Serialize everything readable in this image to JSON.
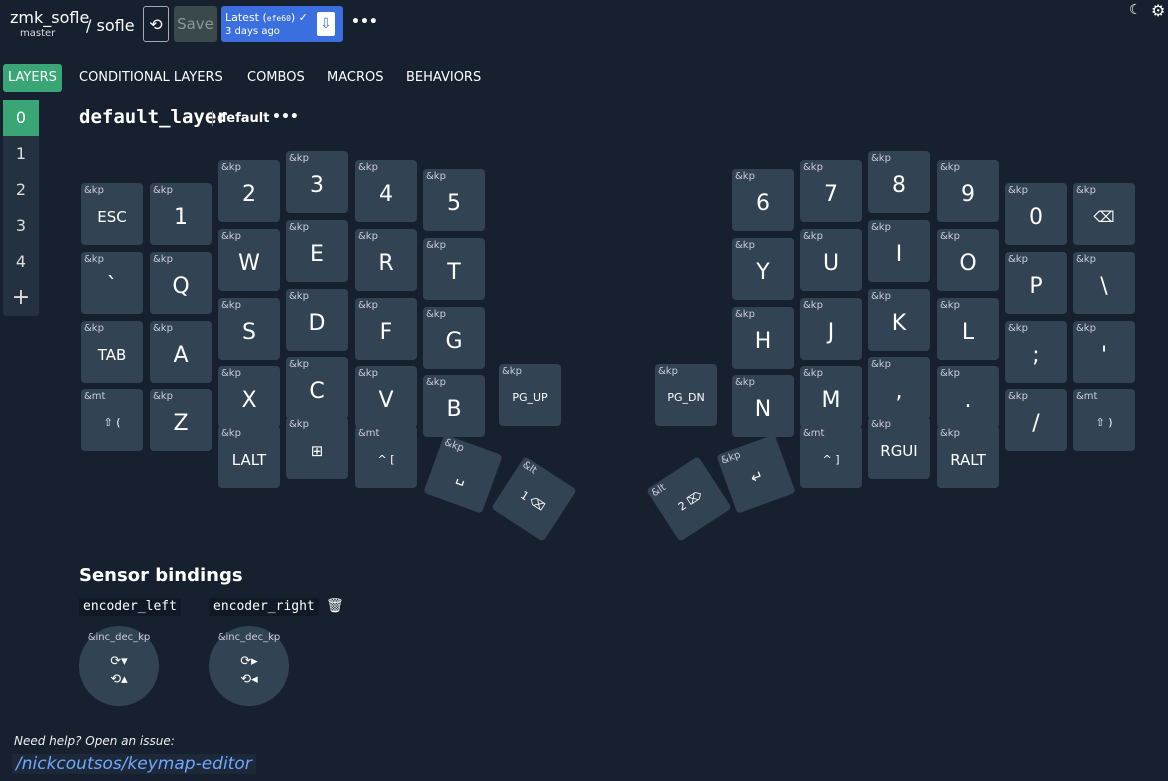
{
  "header": {
    "repo": "zmk_sofle",
    "branch": "master",
    "separator": "/",
    "keyboard": "sofle",
    "refresh_icon": "⟲",
    "save_label": "Save",
    "latest_label": "Latest (",
    "latest_hash": "efe60",
    "latest_close": ") ✓",
    "latest_time": "3 days ago",
    "download_icon": "⇩",
    "more": "•••",
    "moon_icon": "☾",
    "gear_icon": "⚙"
  },
  "tabs": [
    "LAYERS",
    "CONDITIONAL LAYERS",
    "COMBOS",
    "MACROS",
    "BEHAVIORS"
  ],
  "layers": [
    "0",
    "1",
    "2",
    "3",
    "4",
    "+"
  ],
  "layer_title": {
    "name": "default_layer",
    "label": "default",
    "more": "•••"
  },
  "keys": [
    {
      "b": "&kp",
      "p": "ESC",
      "s": "sm"
    },
    {
      "b": "&kp",
      "p": "1"
    },
    {
      "b": "&kp",
      "p": "2"
    },
    {
      "b": "&kp",
      "p": "3"
    },
    {
      "b": "&kp",
      "p": "4"
    },
    {
      "b": "&kp",
      "p": "5"
    },
    {
      "b": "&kp",
      "p": "6"
    },
    {
      "b": "&kp",
      "p": "7"
    },
    {
      "b": "&kp",
      "p": "8"
    },
    {
      "b": "&kp",
      "p": "9"
    },
    {
      "b": "&kp",
      "p": "0"
    },
    {
      "b": "&kp",
      "p": "⌫",
      "s": "sm"
    },
    {
      "b": "&kp",
      "p": "`"
    },
    {
      "b": "&kp",
      "p": "Q"
    },
    {
      "b": "&kp",
      "p": "W"
    },
    {
      "b": "&kp",
      "p": "E"
    },
    {
      "b": "&kp",
      "p": "R"
    },
    {
      "b": "&kp",
      "p": "T"
    },
    {
      "b": "&kp",
      "p": "Y"
    },
    {
      "b": "&kp",
      "p": "U"
    },
    {
      "b": "&kp",
      "p": "I"
    },
    {
      "b": "&kp",
      "p": "O"
    },
    {
      "b": "&kp",
      "p": "P"
    },
    {
      "b": "&kp",
      "p": "\\"
    },
    {
      "b": "&kp",
      "p": "TAB",
      "s": "sm"
    },
    {
      "b": "&kp",
      "p": "A"
    },
    {
      "b": "&kp",
      "p": "S"
    },
    {
      "b": "&kp",
      "p": "D"
    },
    {
      "b": "&kp",
      "p": "F"
    },
    {
      "b": "&kp",
      "p": "G"
    },
    {
      "b": "&kp",
      "p": "H"
    },
    {
      "b": "&kp",
      "p": "J"
    },
    {
      "b": "&kp",
      "p": "K"
    },
    {
      "b": "&kp",
      "p": "L"
    },
    {
      "b": "&kp",
      "p": ";"
    },
    {
      "b": "&kp",
      "p": "'"
    },
    {
      "b": "&mt",
      "p": "⇧ (",
      "s": "xs"
    },
    {
      "b": "&kp",
      "p": "Z"
    },
    {
      "b": "&kp",
      "p": "X"
    },
    {
      "b": "&kp",
      "p": "C"
    },
    {
      "b": "&kp",
      "p": "V"
    },
    {
      "b": "&kp",
      "p": "B"
    },
    {
      "b": "&kp",
      "p": "PG_UP",
      "s": "xs"
    },
    {
      "b": "&kp",
      "p": "PG_DN",
      "s": "xs"
    },
    {
      "b": "&kp",
      "p": "N"
    },
    {
      "b": "&kp",
      "p": "M"
    },
    {
      "b": "&kp",
      "p": ","
    },
    {
      "b": "&kp",
      "p": "."
    },
    {
      "b": "&kp",
      "p": "/"
    },
    {
      "b": "&mt",
      "p": "⇧ )",
      "s": "xs"
    },
    {
      "b": "&kp",
      "p": "LALT",
      "s": "sm"
    },
    {
      "b": "&kp",
      "p": "⊞",
      "s": "sm"
    },
    {
      "b": "&mt",
      "p": "^ [",
      "s": "xs"
    },
    {
      "b": "&kp",
      "p": "␣",
      "s": "sm"
    },
    {
      "b": "&lt",
      "p": "1 ⌫",
      "s": "xs"
    },
    {
      "b": "&lt",
      "p": "2 ⌦",
      "s": "xs"
    },
    {
      "b": "&kp",
      "p": "↵",
      "s": "sm"
    },
    {
      "b": "&mt",
      "p": "^ ]",
      "s": "xs"
    },
    {
      "b": "&kp",
      "p": "RGUI",
      "s": "sm"
    },
    {
      "b": "&kp",
      "p": "RALT",
      "s": "sm"
    }
  ],
  "sensors": {
    "title": "Sensor bindings",
    "left": {
      "name": "encoder_left",
      "binding": "&inc_dec_kp",
      "cw": "⟳▾",
      "ccw": "⟲▴"
    },
    "right": {
      "name": "encoder_right",
      "binding": "&inc_dec_kp",
      "cw": "⟳▸",
      "ccw": "⟲◂"
    },
    "trash_icon": "🗑"
  },
  "footer": {
    "help": "Need help? Open an issue:",
    "link": "/nickcoutsos/keymap-editor"
  }
}
